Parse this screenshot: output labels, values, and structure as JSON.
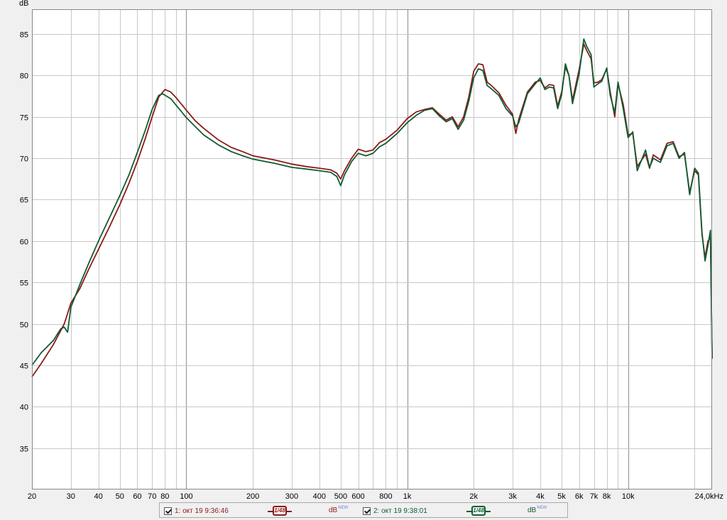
{
  "colors": {
    "series1": "#8b1a1a",
    "series2": "#0f5c32",
    "grid_major": "#999999",
    "grid_minor": "#c8c8c8",
    "plot_bg": "#ffffff"
  },
  "chart_data": {
    "type": "line",
    "ylabel": "dB",
    "xscale": "log",
    "xlim": [
      20,
      24000
    ],
    "ylim": [
      30,
      88
    ],
    "grid": true,
    "x_ticks": [
      {
        "v": 20,
        "label": "20"
      },
      {
        "v": 30,
        "label": "30"
      },
      {
        "v": 40,
        "label": "40"
      },
      {
        "v": 50,
        "label": "50"
      },
      {
        "v": 60,
        "label": "60"
      },
      {
        "v": 70,
        "label": "70"
      },
      {
        "v": 80,
        "label": "80"
      },
      {
        "v": 100,
        "label": "100"
      },
      {
        "v": 200,
        "label": "200"
      },
      {
        "v": 300,
        "label": "300"
      },
      {
        "v": 400,
        "label": "400"
      },
      {
        "v": 500,
        "label": "500"
      },
      {
        "v": 600,
        "label": "600"
      },
      {
        "v": 800,
        "label": "800"
      },
      {
        "v": 1000,
        "label": "1k"
      },
      {
        "v": 2000,
        "label": "2k"
      },
      {
        "v": 3000,
        "label": "3k"
      },
      {
        "v": 4000,
        "label": "4k"
      },
      {
        "v": 5000,
        "label": "5k"
      },
      {
        "v": 6000,
        "label": "6k"
      },
      {
        "v": 7000,
        "label": "7k"
      },
      {
        "v": 8000,
        "label": "8k"
      },
      {
        "v": 10000,
        "label": "10k"
      },
      {
        "v": 24000,
        "label": "24,0kHz"
      }
    ],
    "x_minor": [
      90,
      700,
      900,
      9000,
      20000
    ],
    "x_major": [
      100,
      1000,
      10000
    ],
    "y_ticks": [
      35,
      40,
      45,
      50,
      55,
      60,
      65,
      70,
      75,
      80,
      85
    ],
    "series": [
      {
        "name": "1: окт 19 9:36:46",
        "color": "#8b1a1a",
        "points": [
          [
            20,
            43.6
          ],
          [
            22,
            45.2
          ],
          [
            25,
            47.5
          ],
          [
            28,
            50.0
          ],
          [
            30,
            52.5
          ],
          [
            33,
            54.3
          ],
          [
            36,
            56.5
          ],
          [
            40,
            59.0
          ],
          [
            45,
            61.8
          ],
          [
            50,
            64.4
          ],
          [
            55,
            67.0
          ],
          [
            60,
            69.6
          ],
          [
            65,
            72.3
          ],
          [
            70,
            75.0
          ],
          [
            75,
            77.4
          ],
          [
            80,
            78.3
          ],
          [
            85,
            78.0
          ],
          [
            90,
            77.3
          ],
          [
            100,
            75.8
          ],
          [
            110,
            74.5
          ],
          [
            120,
            73.6
          ],
          [
            140,
            72.2
          ],
          [
            160,
            71.3
          ],
          [
            180,
            70.8
          ],
          [
            200,
            70.3
          ],
          [
            250,
            69.8
          ],
          [
            300,
            69.3
          ],
          [
            350,
            69.0
          ],
          [
            400,
            68.8
          ],
          [
            450,
            68.6
          ],
          [
            480,
            68.2
          ],
          [
            500,
            67.5
          ],
          [
            520,
            68.5
          ],
          [
            560,
            70.0
          ],
          [
            600,
            71.1
          ],
          [
            650,
            70.8
          ],
          [
            700,
            71.0
          ],
          [
            750,
            71.9
          ],
          [
            800,
            72.3
          ],
          [
            900,
            73.4
          ],
          [
            1000,
            74.8
          ],
          [
            1100,
            75.6
          ],
          [
            1200,
            75.9
          ],
          [
            1300,
            76.1
          ],
          [
            1400,
            75.3
          ],
          [
            1500,
            74.6
          ],
          [
            1600,
            75.0
          ],
          [
            1700,
            73.8
          ],
          [
            1800,
            75.0
          ],
          [
            1900,
            77.4
          ],
          [
            2000,
            80.5
          ],
          [
            2100,
            81.4
          ],
          [
            2200,
            81.3
          ],
          [
            2300,
            79.2
          ],
          [
            2400,
            78.8
          ],
          [
            2600,
            77.9
          ],
          [
            2800,
            76.4
          ],
          [
            3000,
            75.3
          ],
          [
            3100,
            73.0
          ],
          [
            3200,
            74.7
          ],
          [
            3500,
            78.0
          ],
          [
            3800,
            79.2
          ],
          [
            4000,
            79.4
          ],
          [
            4200,
            78.5
          ],
          [
            4400,
            78.9
          ],
          [
            4600,
            78.8
          ],
          [
            4800,
            76.3
          ],
          [
            5000,
            78.0
          ],
          [
            5200,
            81.0
          ],
          [
            5400,
            80.0
          ],
          [
            5600,
            77.0
          ],
          [
            6000,
            80.7
          ],
          [
            6300,
            83.8
          ],
          [
            6500,
            83.0
          ],
          [
            6800,
            82.0
          ],
          [
            7000,
            79.1
          ],
          [
            7300,
            79.2
          ],
          [
            7600,
            79.5
          ],
          [
            8000,
            80.8
          ],
          [
            8300,
            78.0
          ],
          [
            8700,
            75.0
          ],
          [
            9000,
            79.0
          ],
          [
            9500,
            76.5
          ],
          [
            10000,
            72.8
          ],
          [
            10500,
            73.0
          ],
          [
            11000,
            69.0
          ],
          [
            12000,
            70.5
          ],
          [
            12500,
            68.8
          ],
          [
            13000,
            70.4
          ],
          [
            14000,
            69.8
          ],
          [
            15000,
            71.8
          ],
          [
            16000,
            72.0
          ],
          [
            17000,
            70.2
          ],
          [
            18000,
            70.5
          ],
          [
            19000,
            65.9
          ],
          [
            20000,
            68.5
          ],
          [
            20800,
            68.0
          ],
          [
            21600,
            60.8
          ],
          [
            22300,
            58.0
          ],
          [
            23000,
            60.0
          ],
          [
            23600,
            60.5
          ],
          [
            24000,
            45.8
          ]
        ]
      },
      {
        "name": "2: окт 19 9:38:01",
        "color": "#0f5c32",
        "points": [
          [
            20,
            45.0
          ],
          [
            22,
            46.5
          ],
          [
            25,
            48.0
          ],
          [
            27,
            49.4
          ],
          [
            28,
            49.6
          ],
          [
            29,
            49.0
          ],
          [
            30,
            52.0
          ],
          [
            33,
            54.8
          ],
          [
            36,
            57.2
          ],
          [
            40,
            60.0
          ],
          [
            45,
            62.9
          ],
          [
            50,
            65.5
          ],
          [
            55,
            68.0
          ],
          [
            60,
            70.7
          ],
          [
            65,
            73.3
          ],
          [
            70,
            75.9
          ],
          [
            75,
            77.6
          ],
          [
            78,
            77.8
          ],
          [
            85,
            77.2
          ],
          [
            90,
            76.4
          ],
          [
            100,
            74.9
          ],
          [
            110,
            73.8
          ],
          [
            120,
            72.8
          ],
          [
            140,
            71.6
          ],
          [
            160,
            70.8
          ],
          [
            180,
            70.3
          ],
          [
            200,
            69.9
          ],
          [
            250,
            69.4
          ],
          [
            300,
            68.9
          ],
          [
            350,
            68.7
          ],
          [
            400,
            68.5
          ],
          [
            450,
            68.3
          ],
          [
            480,
            67.8
          ],
          [
            500,
            66.7
          ],
          [
            520,
            68.0
          ],
          [
            560,
            69.6
          ],
          [
            600,
            70.6
          ],
          [
            650,
            70.3
          ],
          [
            700,
            70.6
          ],
          [
            750,
            71.4
          ],
          [
            800,
            71.8
          ],
          [
            900,
            73.0
          ],
          [
            1000,
            74.3
          ],
          [
            1100,
            75.2
          ],
          [
            1200,
            75.8
          ],
          [
            1300,
            76.0
          ],
          [
            1400,
            75.1
          ],
          [
            1500,
            74.4
          ],
          [
            1600,
            74.8
          ],
          [
            1700,
            73.5
          ],
          [
            1800,
            74.6
          ],
          [
            1900,
            76.9
          ],
          [
            2000,
            79.7
          ],
          [
            2100,
            80.8
          ],
          [
            2200,
            80.6
          ],
          [
            2300,
            78.8
          ],
          [
            2400,
            78.4
          ],
          [
            2600,
            77.6
          ],
          [
            2800,
            76.0
          ],
          [
            3000,
            75.1
          ],
          [
            3100,
            73.8
          ],
          [
            3200,
            74.3
          ],
          [
            3500,
            77.8
          ],
          [
            3800,
            79.0
          ],
          [
            4000,
            79.7
          ],
          [
            4200,
            78.3
          ],
          [
            4400,
            78.6
          ],
          [
            4600,
            78.5
          ],
          [
            4800,
            76.0
          ],
          [
            5000,
            77.7
          ],
          [
            5200,
            81.4
          ],
          [
            5400,
            80.0
          ],
          [
            5600,
            76.6
          ],
          [
            6000,
            80.2
          ],
          [
            6300,
            84.4
          ],
          [
            6500,
            83.5
          ],
          [
            6800,
            82.5
          ],
          [
            7000,
            78.6
          ],
          [
            7300,
            79.0
          ],
          [
            7600,
            79.3
          ],
          [
            8000,
            80.9
          ],
          [
            8300,
            77.6
          ],
          [
            8700,
            75.5
          ],
          [
            9000,
            79.2
          ],
          [
            9500,
            76.0
          ],
          [
            10000,
            72.5
          ],
          [
            10500,
            73.2
          ],
          [
            11000,
            68.5
          ],
          [
            12000,
            71.0
          ],
          [
            12500,
            68.9
          ],
          [
            13000,
            70.0
          ],
          [
            14000,
            69.5
          ],
          [
            15000,
            71.5
          ],
          [
            16000,
            71.8
          ],
          [
            17000,
            70.0
          ],
          [
            18000,
            70.7
          ],
          [
            19000,
            65.6
          ],
          [
            20000,
            68.8
          ],
          [
            20800,
            68.2
          ],
          [
            21600,
            61.0
          ],
          [
            22300,
            57.6
          ],
          [
            23000,
            59.5
          ],
          [
            23600,
            61.3
          ],
          [
            24000,
            45.8
          ]
        ]
      }
    ]
  },
  "legend": {
    "item1_label": "1: окт 19 9:36:46",
    "item2_label": "2: окт 19 9:38:01",
    "smoothing_label": "1/48",
    "unit_label": "dB",
    "unit_badge": "NEW"
  }
}
